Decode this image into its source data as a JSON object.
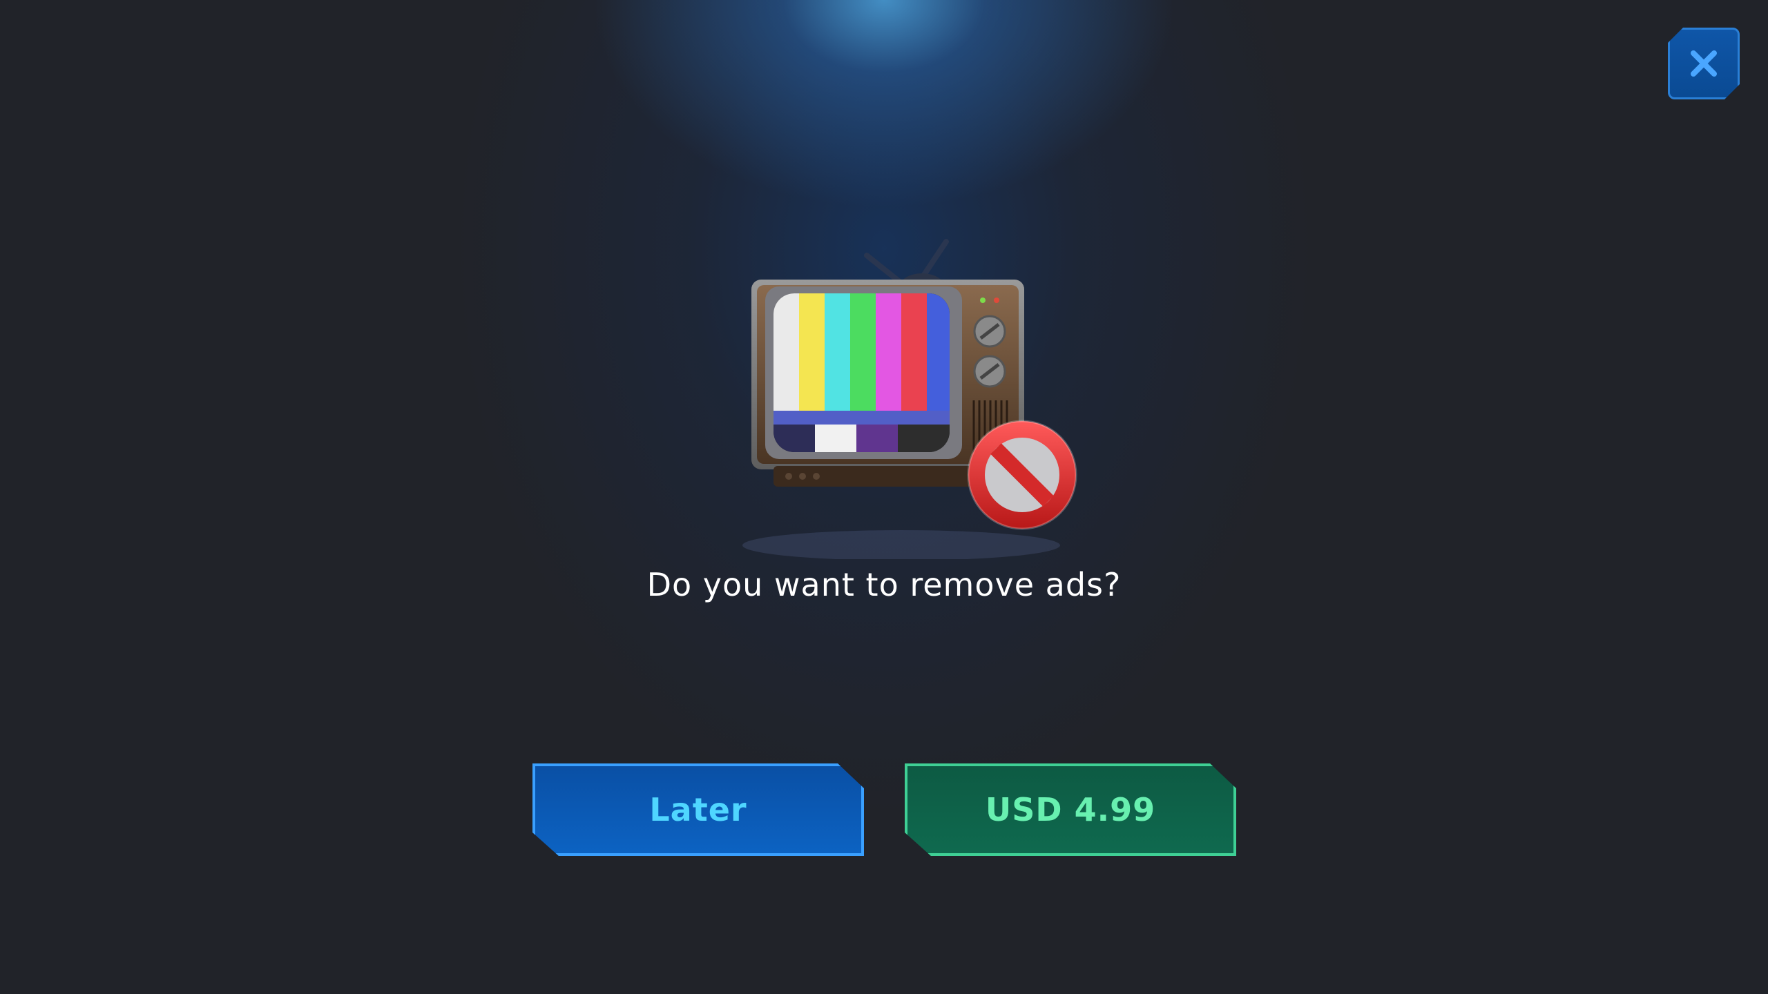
{
  "dialog": {
    "prompt": "Do you want to remove ads?"
  },
  "buttons": {
    "later_label": "Later",
    "buy_label": "USD 4.99"
  },
  "icons": {
    "close": "close-icon",
    "tv": "retro-tv-icon",
    "no_sign": "prohibited-icon"
  },
  "colors": {
    "background": "#212329",
    "later_button": "#0c5fbd",
    "later_text": "#4fd6ff",
    "buy_button": "#0e6349",
    "buy_text": "#68f0b0",
    "close_button": "#0c50a0"
  }
}
